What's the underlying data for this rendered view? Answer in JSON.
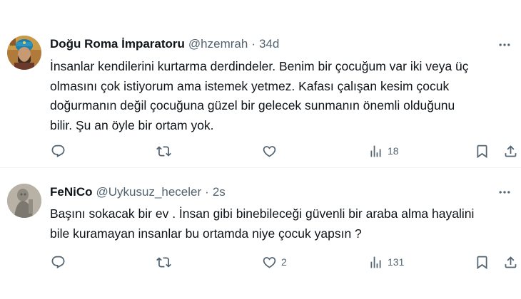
{
  "tweets": [
    {
      "display_name": "Doğu Roma İmparatoru",
      "handle": "@hzemrah",
      "separator": "·",
      "time": "34d",
      "lines": [
        "İnsanlar kendilerini kurtarma derdindeler. Benim bir çocuğum var iki veya üç",
        "olmasını çok istiyorum ama istemek yetmez. Kafası çalışan kesim çocuk",
        "doğurmanın değil çocuğuna güzel bir gelecek sunmanın önemli olduğunu",
        "bilir. Şu an öyle bir ortam yok."
      ],
      "reply_count": "",
      "retweet_count": "",
      "like_count": "",
      "view_count": "18"
    },
    {
      "display_name": "FeNiCo",
      "handle": "@Uykusuz_heceler",
      "separator": "·",
      "time": "2s",
      "lines": [
        "Başını sokacak bir ev . İnsan gibi binebileceği güvenli bir araba alma hayalini",
        "bile kuramayan insanlar bu ortamda niye çocuk yapsın ?"
      ],
      "reply_count": "",
      "retweet_count": "",
      "like_count": "2",
      "view_count": "131"
    }
  ],
  "icons": {
    "reply": "reply-icon",
    "retweet": "retweet-icon",
    "like": "heart-icon",
    "views": "views-icon",
    "bookmark": "bookmark-icon",
    "share": "share-icon",
    "more": "more-icon"
  },
  "colors": {
    "text": "#0f1419",
    "secondary": "#536471",
    "divider": "#eff3f4"
  }
}
